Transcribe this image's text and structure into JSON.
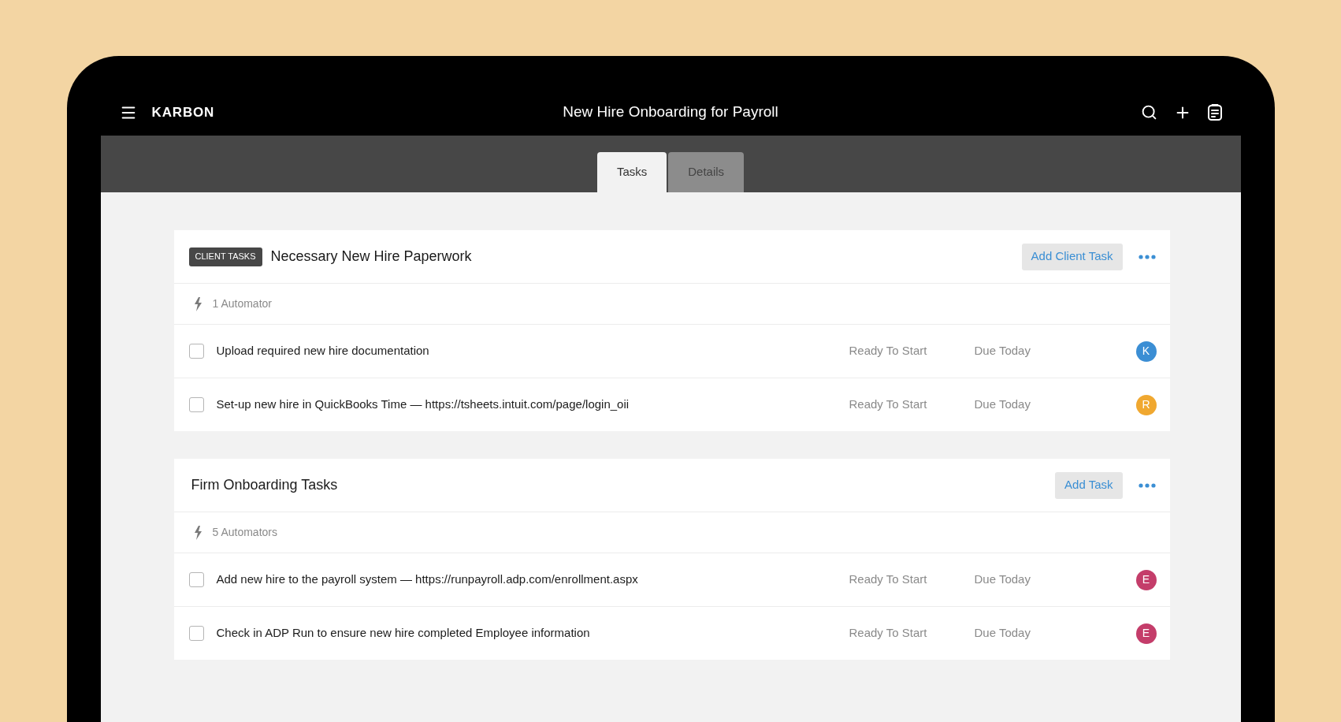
{
  "app": {
    "brand": "KARBON",
    "title": "New Hire Onboarding for Payroll"
  },
  "tabs": [
    {
      "label": "Tasks",
      "selected": true
    },
    {
      "label": "Details",
      "selected": false
    }
  ],
  "sections": [
    {
      "badge": "CLIENT TASKS",
      "title": "Necessary New Hire Paperwork",
      "action": "Add Client Task",
      "automators": "1 Automator",
      "tasks": [
        {
          "title": "Upload required new hire documentation",
          "checked": false,
          "status": "Ready To Start",
          "due": "Due Today",
          "assignee": {
            "initial": "K",
            "color": "#3b8ed4"
          }
        },
        {
          "title": "Set-up new hire in QuickBooks Time — https://tsheets.intuit.com/page/login_oii",
          "checked": false,
          "status": "Ready To Start",
          "due": "Due Today",
          "assignee": {
            "initial": "R",
            "color": "#f0a830"
          }
        }
      ]
    },
    {
      "title": "Firm Onboarding Tasks",
      "action": "Add Task",
      "automators": "5 Automators",
      "tasks": [
        {
          "title": "Add new hire to the payroll system — https://runpayroll.adp.com/enrollment.aspx",
          "checked": false,
          "status": "Ready To Start",
          "due": "Due Today",
          "assignee": {
            "initial": "E",
            "color": "#c43d6a"
          }
        },
        {
          "title": "Check in ADP Run to ensure new hire completed Employee information",
          "checked": false,
          "status": "Ready To Start",
          "due": "Due Today",
          "assignee": {
            "initial": "E",
            "color": "#c43d6a"
          }
        }
      ]
    }
  ]
}
